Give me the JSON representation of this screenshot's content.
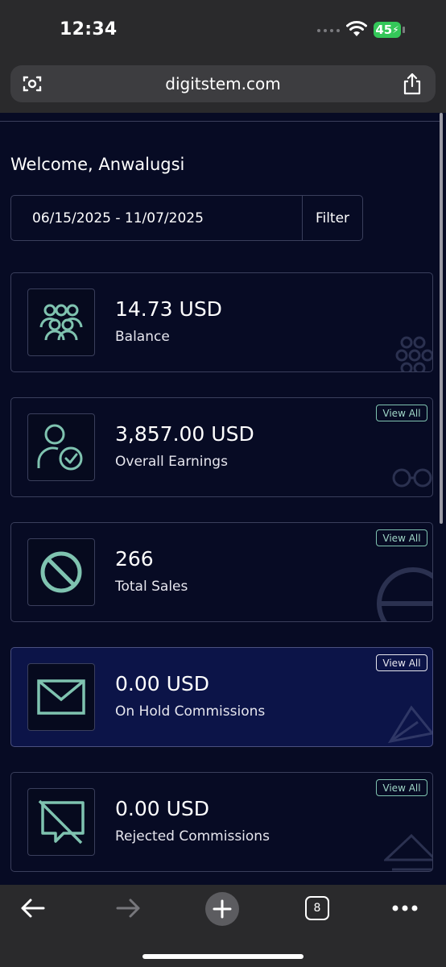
{
  "status_bar": {
    "time": "12:34",
    "battery": "45"
  },
  "browser": {
    "url": "digitstem.com",
    "tab_count": "8"
  },
  "welcome": "Welcome, Anwalugsi",
  "date_filter": {
    "range": "06/15/2025 - 11/07/2025",
    "button": "Filter"
  },
  "cards": [
    {
      "value": "14.73 USD",
      "label": "Balance",
      "icon": "people-group-icon"
    },
    {
      "value": "3,857.00 USD",
      "label": "Overall Earnings",
      "icon": "user-check-icon",
      "action": "View All"
    },
    {
      "value": "266",
      "label": "Total Sales",
      "icon": "ban-icon",
      "action": "View All"
    },
    {
      "value": "0.00 USD",
      "label": "On Hold Commissions",
      "icon": "envelope-icon",
      "action": "View All"
    },
    {
      "value": "0.00 USD",
      "label": "Rejected Commissions",
      "icon": "comment-slash-icon",
      "action": "View All"
    }
  ],
  "colors": {
    "accent": "#7fc3b0",
    "background": "#070b24",
    "highlight_card": "#0c1448"
  }
}
